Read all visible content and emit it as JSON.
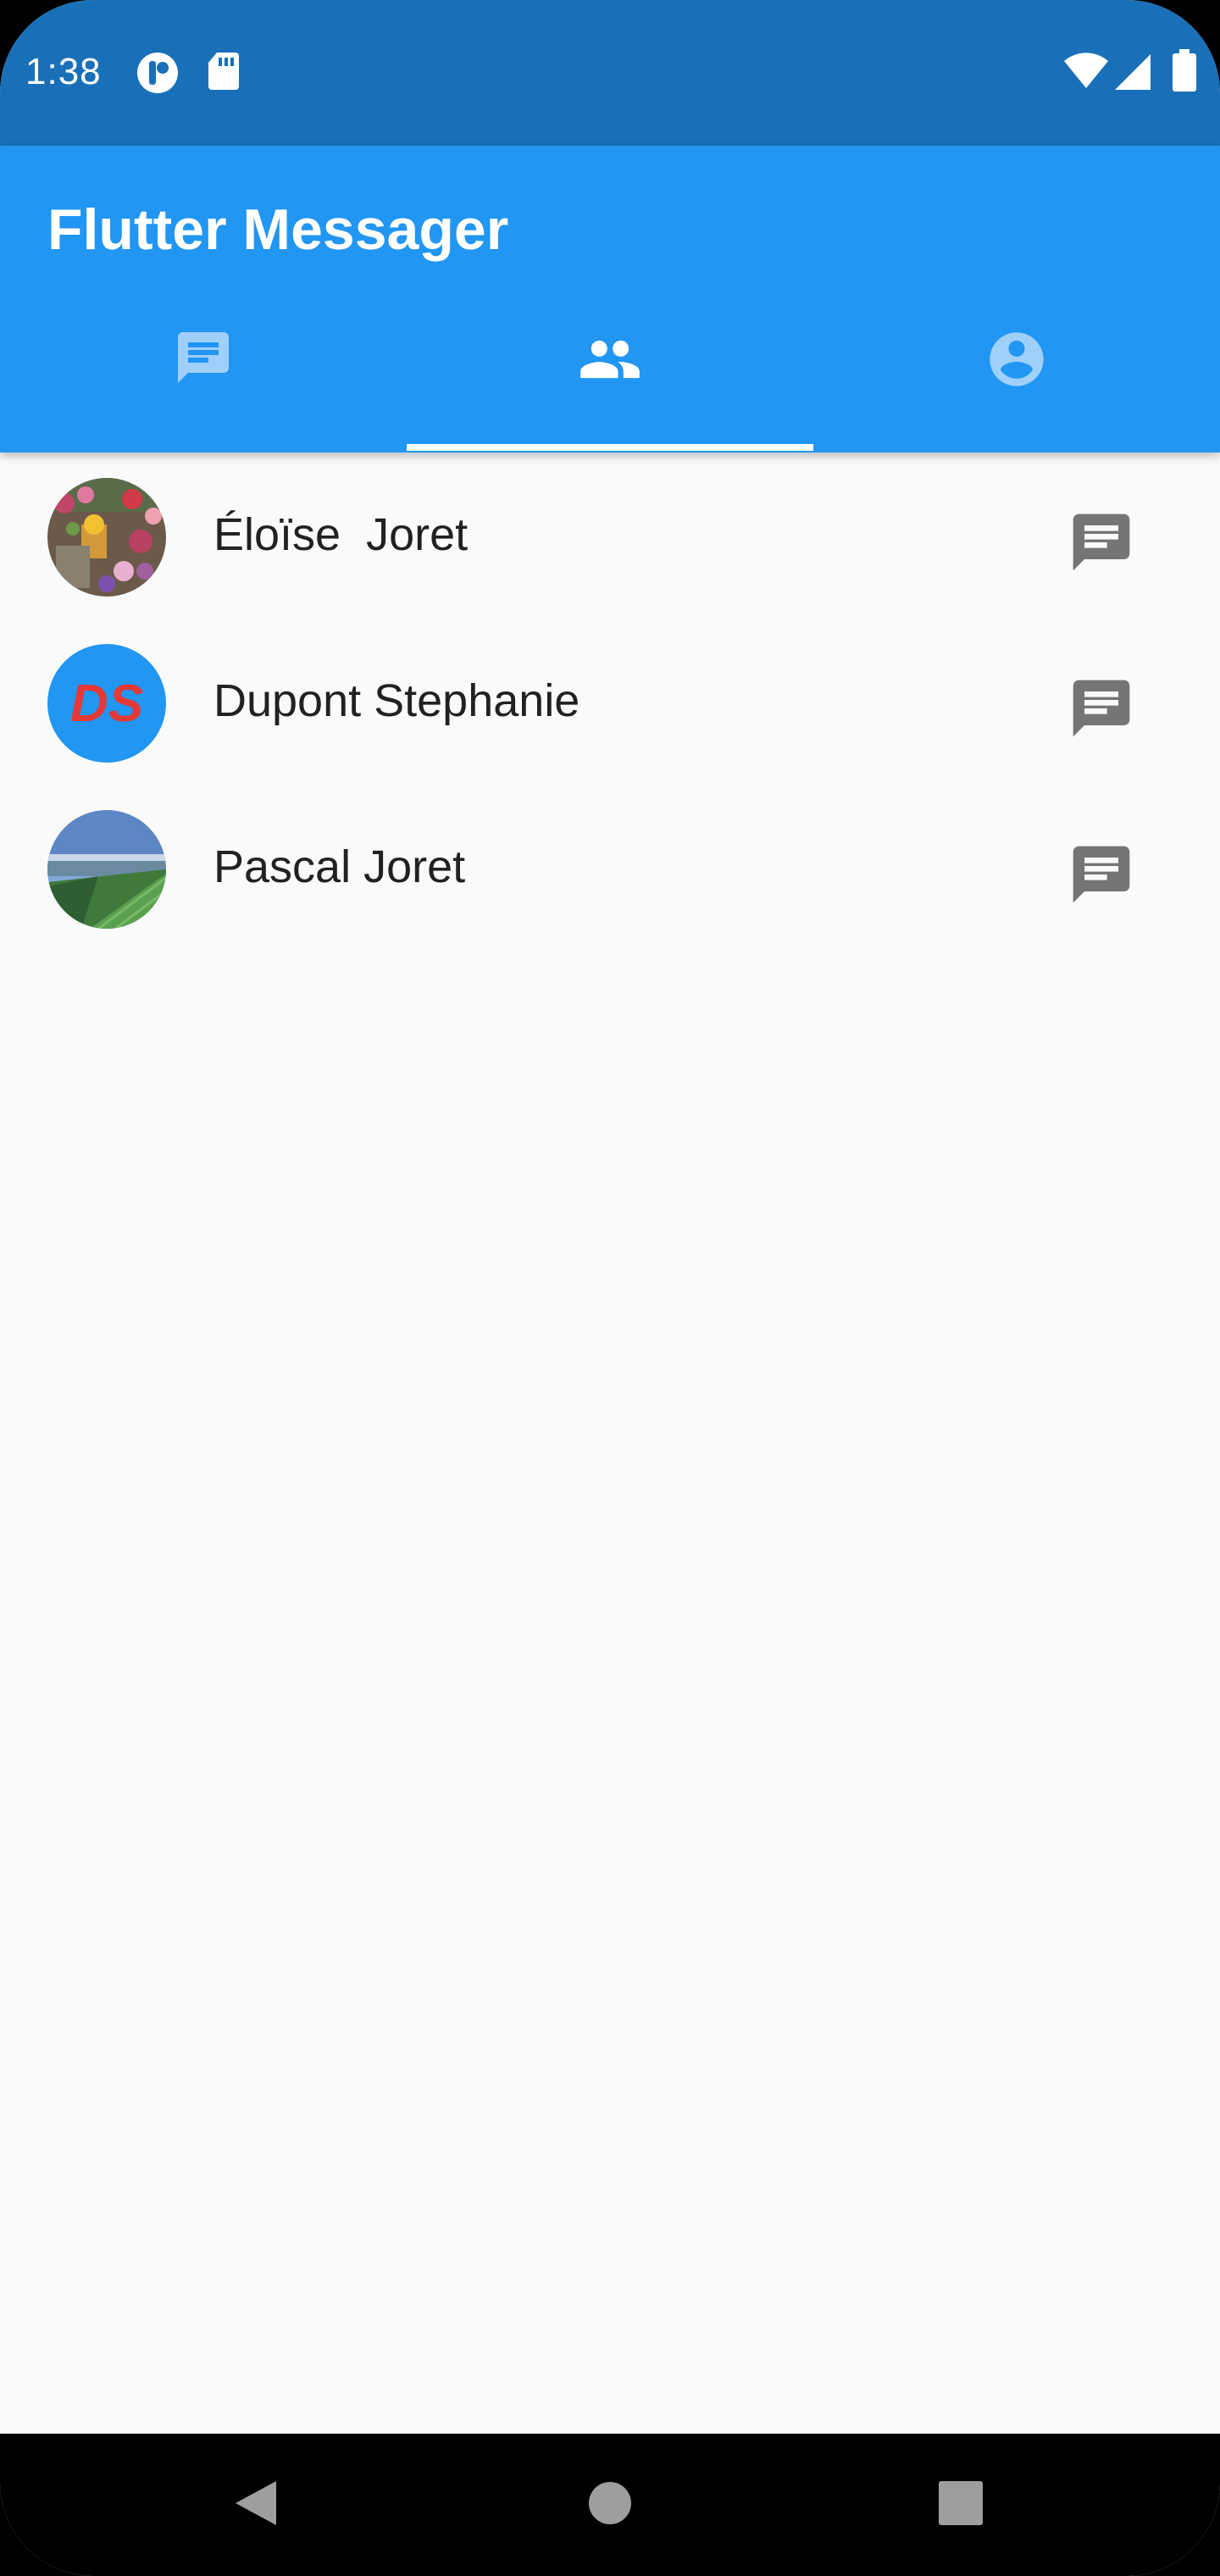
{
  "status_bar": {
    "time": "1:38",
    "icons": [
      "notification-app-icon",
      "sd-card-icon",
      "wifi-icon",
      "signal-icon",
      "battery-icon"
    ]
  },
  "app_bar": {
    "title": "Flutter Messager",
    "background_color": "#2196f3",
    "tabs": [
      {
        "icon": "chat-icon",
        "selected": false
      },
      {
        "icon": "people-icon",
        "selected": true
      },
      {
        "icon": "account-circle-icon",
        "selected": false
      }
    ]
  },
  "contacts": [
    {
      "name": "Éloïse  Joret",
      "avatar": "flowers-photo",
      "action_icon": "message-icon"
    },
    {
      "name": "Dupont Stephanie",
      "avatar_initials": "DS",
      "action_icon": "message-icon"
    },
    {
      "name": "Pascal Joret",
      "avatar": "landscape-photo",
      "action_icon": "message-icon"
    }
  ],
  "nav_bar": {
    "buttons": [
      "back-icon",
      "home-icon",
      "recents-icon"
    ]
  },
  "colors": {
    "status_bar": "#1a70b8",
    "app_bar": "#2196f3",
    "initials_text": "#e53935",
    "list_background": "#fafafa",
    "action_icon": "#757575"
  }
}
